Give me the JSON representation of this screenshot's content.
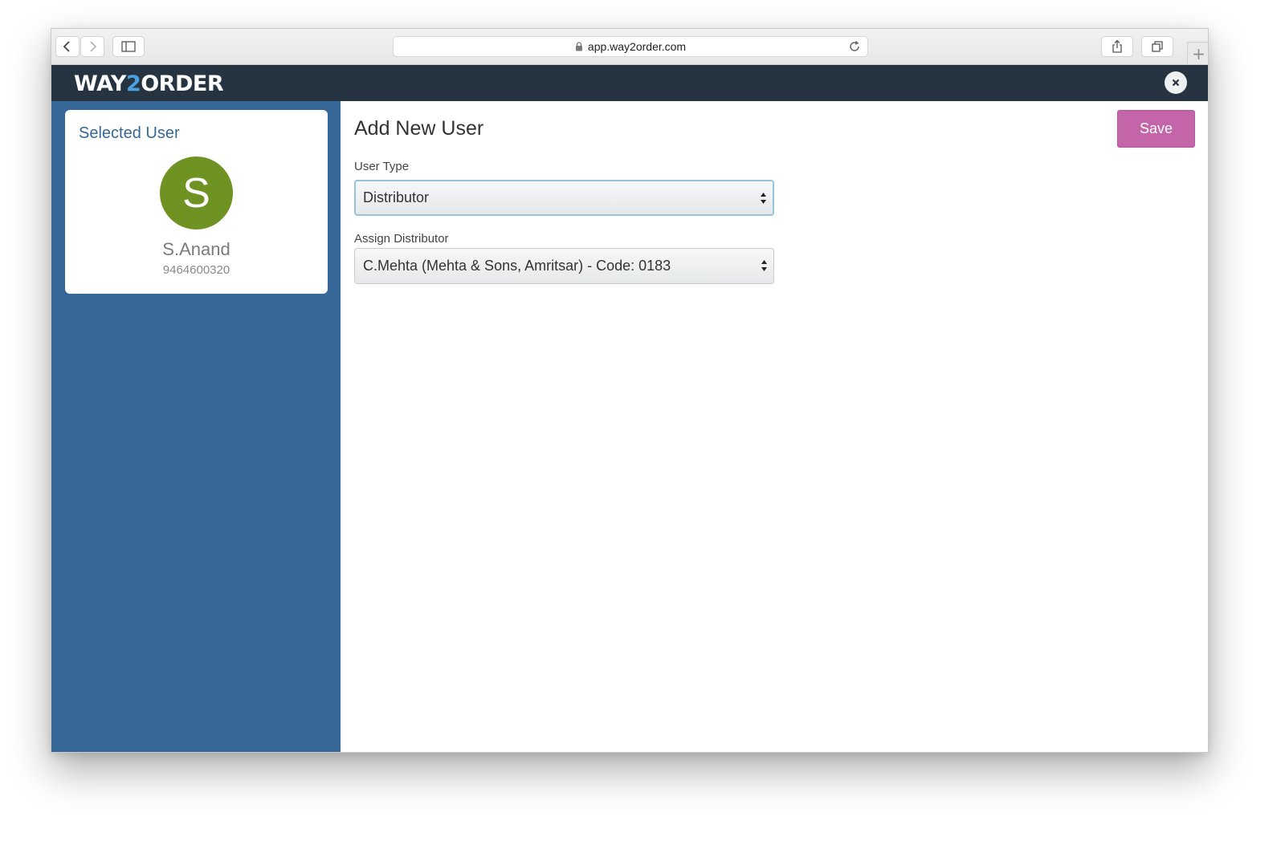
{
  "browser": {
    "url": "app.way2order.com"
  },
  "app": {
    "logo_part1": "WAY",
    "logo_part2": "2",
    "logo_part3": "ORDER",
    "header_color": "#263340",
    "accent_color": "#4aa3df"
  },
  "sidebar": {
    "card_title": "Selected User",
    "avatar_initial": "S",
    "user_name": "S.Anand",
    "user_phone": "9464600320",
    "sidebar_color": "#376796",
    "avatar_color": "#6f9322"
  },
  "main": {
    "title": "Add New User",
    "save_label": "Save",
    "save_color": "#c565a9",
    "user_type": {
      "label": "User Type",
      "value": "Distributor"
    },
    "assign_distributor": {
      "label": "Assign Distributor",
      "value": "C.Mehta (Mehta & Sons, Amritsar) - Code: 0183"
    }
  },
  "icons": [
    "back-icon",
    "forward-icon",
    "sidebar-toggle-icon",
    "lock-icon",
    "reload-icon",
    "share-icon",
    "tabs-icon",
    "plus-icon",
    "close-icon",
    "select-arrows-icon"
  ]
}
